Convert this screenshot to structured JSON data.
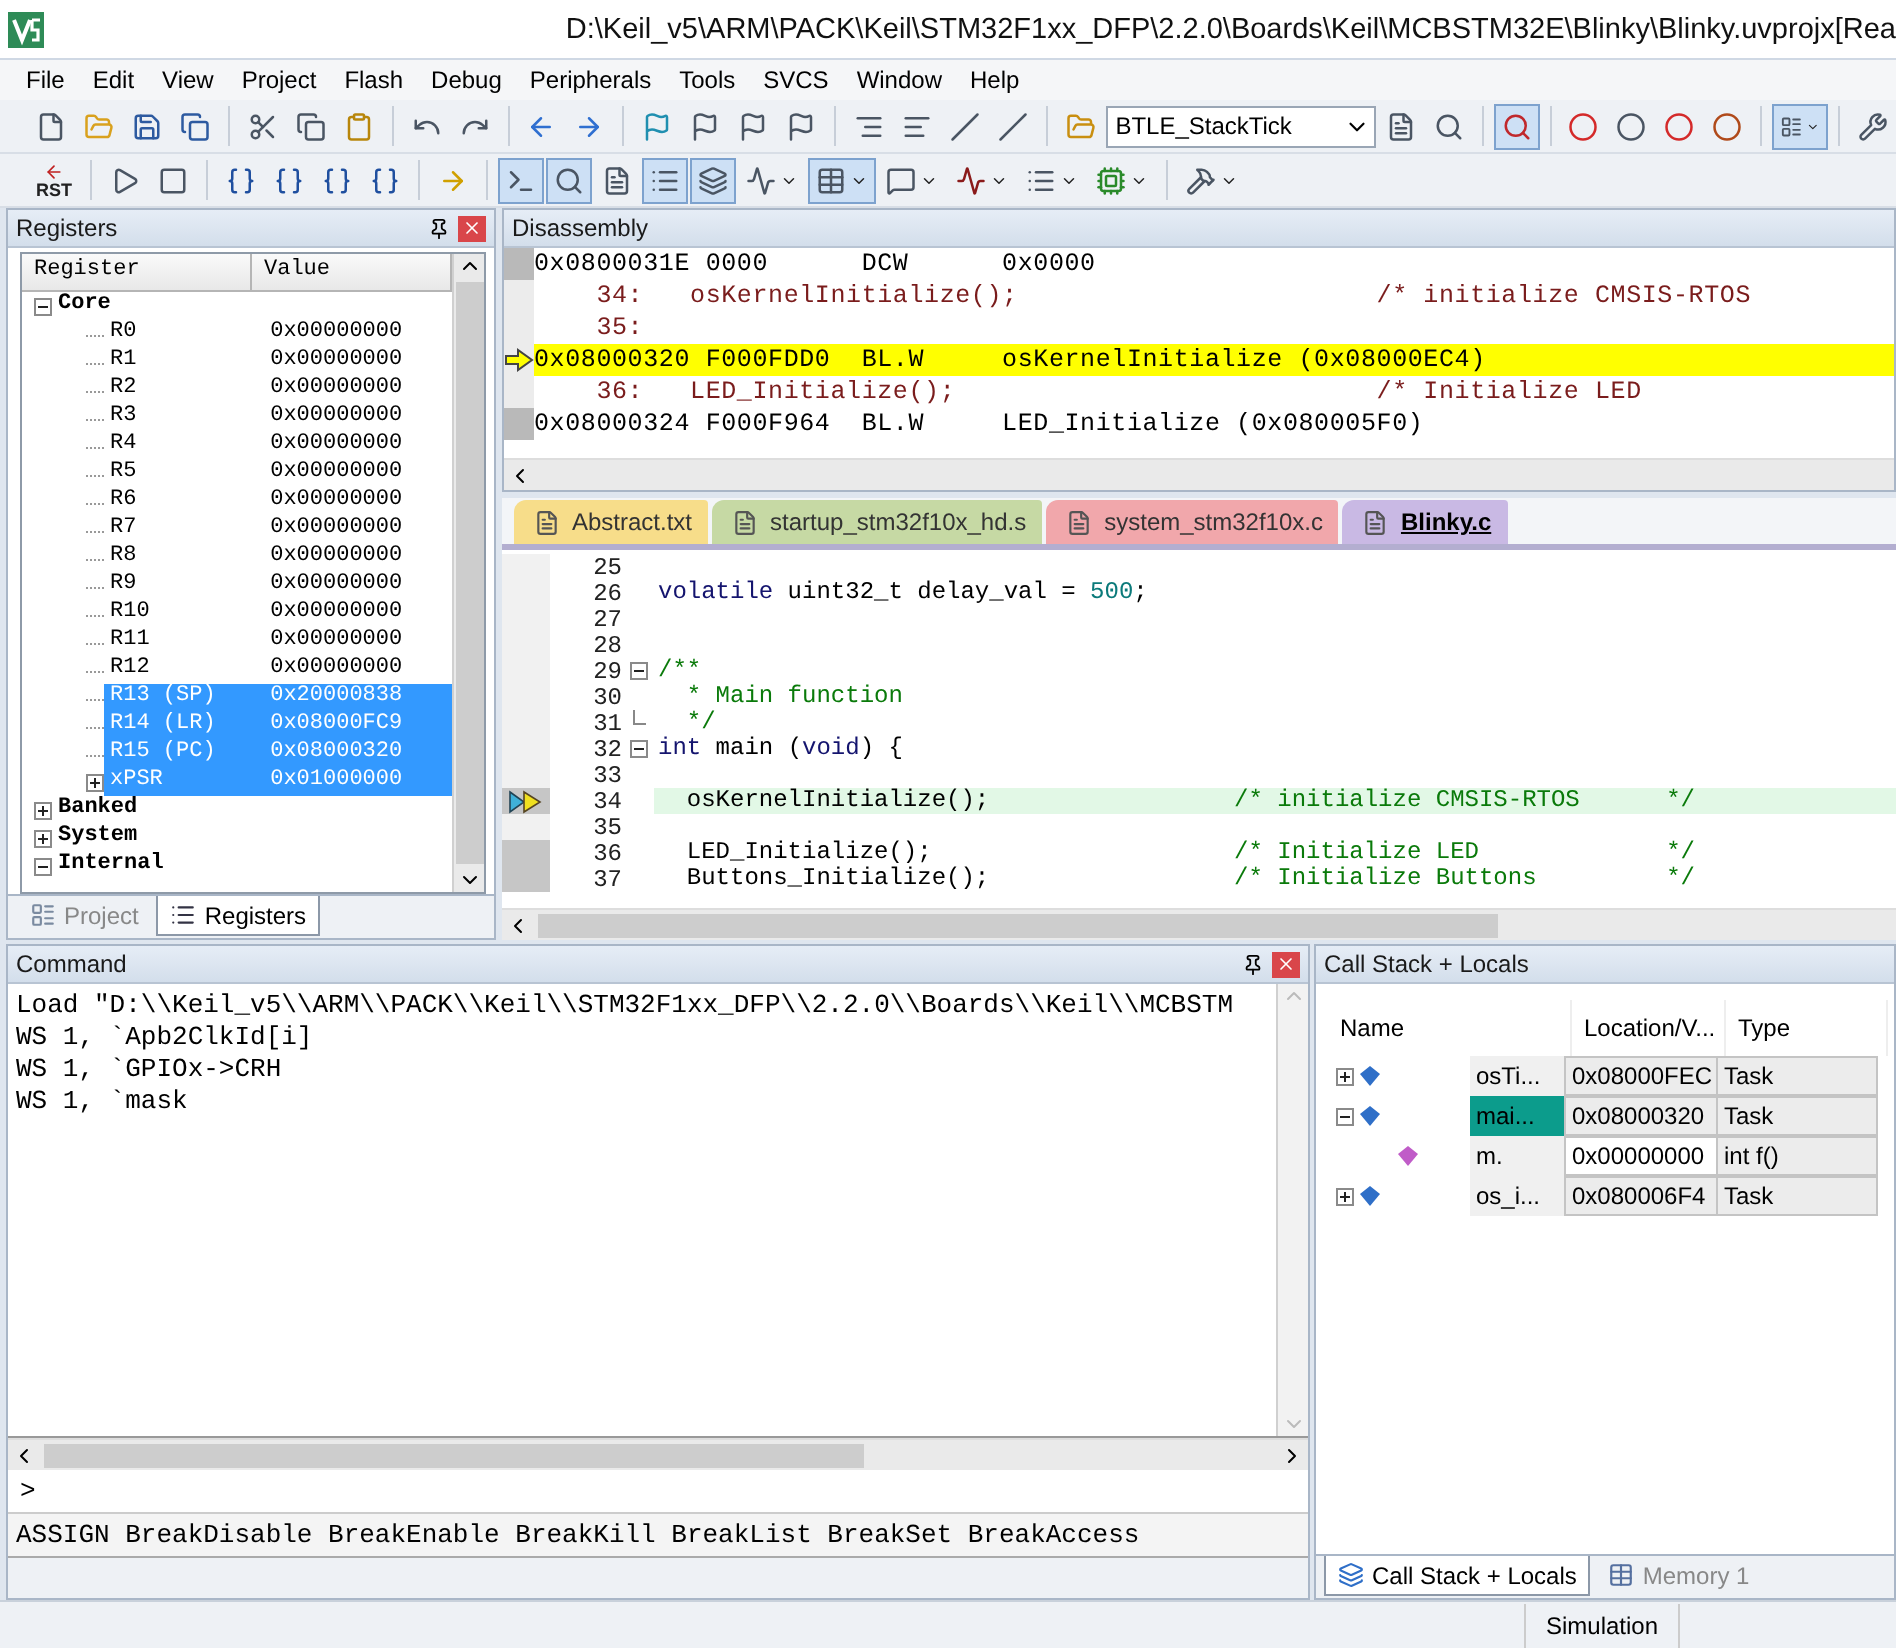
{
  "window": {
    "title": "D:\\Keil_v5\\ARM\\PACK\\Keil\\STM32F1xx_DFP\\2.2.0\\Boards\\Keil\\MCBSTM32E\\Blinky\\Blinky.uvprojx[Rea"
  },
  "menu": [
    "File",
    "Edit",
    "View",
    "Project",
    "Flash",
    "Debug",
    "Peripherals",
    "Tools",
    "SVCS",
    "Window",
    "Help"
  ],
  "toolbar": [
    {
      "kind": "new",
      "pressed": false
    },
    {
      "kind": "open",
      "pressed": false
    },
    {
      "kind": "save",
      "pressed": false
    },
    {
      "kind": "save-all",
      "pressed": false
    },
    {
      "kind": "sep"
    },
    {
      "kind": "cut",
      "pressed": false
    },
    {
      "kind": "copy",
      "pressed": false
    },
    {
      "kind": "paste",
      "pressed": false
    },
    {
      "kind": "sep"
    },
    {
      "kind": "undo",
      "pressed": false
    },
    {
      "kind": "redo",
      "pressed": false
    },
    {
      "kind": "sep"
    },
    {
      "kind": "back",
      "pressed": false
    },
    {
      "kind": "forward",
      "pressed": false
    },
    {
      "kind": "sep"
    },
    {
      "kind": "bookmark",
      "pressed": false
    },
    {
      "kind": "bookmark-prev",
      "pressed": false
    },
    {
      "kind": "bookmark-next",
      "pressed": false
    },
    {
      "kind": "bookmark-clear",
      "pressed": false
    },
    {
      "kind": "sep"
    },
    {
      "kind": "indent",
      "pressed": false
    },
    {
      "kind": "outdent",
      "pressed": false
    },
    {
      "kind": "comment",
      "pressed": false
    },
    {
      "kind": "uncomment",
      "pressed": false
    },
    {
      "kind": "sep"
    },
    {
      "kind": "find-files",
      "pressed": false
    },
    {
      "kind": "combo",
      "value": "BTLE_StackTick"
    },
    {
      "kind": "find",
      "pressed": false
    },
    {
      "kind": "incremental",
      "pressed": false
    },
    {
      "kind": "sep"
    },
    {
      "kind": "debug",
      "pressed": true
    },
    {
      "kind": "sep"
    },
    {
      "kind": "breakpoint",
      "pressed": false
    },
    {
      "kind": "breakpoint-off",
      "pressed": false
    },
    {
      "kind": "kill-breakpoints",
      "pressed": false
    },
    {
      "kind": "disable-breakpoints",
      "pressed": false
    },
    {
      "kind": "sep"
    },
    {
      "kind": "windows",
      "pressed": true,
      "menu": true
    },
    {
      "kind": "sep"
    },
    {
      "kind": "config",
      "pressed": false
    }
  ],
  "debug_toolbar": [
    {
      "kind": "reset",
      "label": "RST",
      "pressed": false
    },
    {
      "kind": "sep"
    },
    {
      "kind": "run",
      "pressed": false
    },
    {
      "kind": "stop",
      "pressed": false
    },
    {
      "kind": "sep"
    },
    {
      "kind": "step",
      "pressed": false
    },
    {
      "kind": "step-over",
      "pressed": false
    },
    {
      "kind": "step-out",
      "pressed": false
    },
    {
      "kind": "run-to-cursor",
      "pressed": false
    },
    {
      "kind": "sep"
    },
    {
      "kind": "show-next",
      "pressed": false
    },
    {
      "kind": "sep"
    },
    {
      "kind": "command-window",
      "pressed": true
    },
    {
      "kind": "disassembly-window",
      "pressed": true
    },
    {
      "kind": "symbols-window",
      "pressed": false
    },
    {
      "kind": "registers-window",
      "pressed": true
    },
    {
      "kind": "call-stack-window",
      "pressed": true
    },
    {
      "kind": "watch-window",
      "pressed": false,
      "menu": true
    },
    {
      "kind": "memory-window",
      "pressed": true,
      "menu": true
    },
    {
      "kind": "serial-window",
      "pressed": false,
      "menu": true
    },
    {
      "kind": "analysis-window",
      "pressed": false,
      "menu": true
    },
    {
      "kind": "trace-window",
      "pressed": false,
      "menu": true
    },
    {
      "kind": "system-viewer",
      "pressed": false,
      "menu": true
    },
    {
      "kind": "sep"
    },
    {
      "kind": "toolbox",
      "pressed": false,
      "menu": true
    }
  ],
  "registers": {
    "title": "Registers",
    "columns": [
      "Register",
      "Value"
    ],
    "tree": [
      {
        "name": "Core",
        "expanded": true,
        "selected": false,
        "children": [
          {
            "name": "R0",
            "value": "0x00000000",
            "selected": false
          },
          {
            "name": "R1",
            "value": "0x00000000",
            "selected": false
          },
          {
            "name": "R2",
            "value": "0x00000000",
            "selected": false
          },
          {
            "name": "R3",
            "value": "0x00000000",
            "selected": false
          },
          {
            "name": "R4",
            "value": "0x00000000",
            "selected": false
          },
          {
            "name": "R5",
            "value": "0x00000000",
            "selected": false
          },
          {
            "name": "R6",
            "value": "0x00000000",
            "selected": false
          },
          {
            "name": "R7",
            "value": "0x00000000",
            "selected": false
          },
          {
            "name": "R8",
            "value": "0x00000000",
            "selected": false
          },
          {
            "name": "R9",
            "value": "0x00000000",
            "selected": false
          },
          {
            "name": "R10",
            "value": "0x00000000",
            "selected": false
          },
          {
            "name": "R11",
            "value": "0x00000000",
            "selected": false
          },
          {
            "name": "R12",
            "value": "0x00000000",
            "selected": false
          },
          {
            "name": "R13 (SP)",
            "value": "0x20000838",
            "selected": true
          },
          {
            "name": "R14 (LR)",
            "value": "0x08000FC9",
            "selected": true
          },
          {
            "name": "R15 (PC)",
            "value": "0x08000320",
            "selected": true
          },
          {
            "name": "xPSR",
            "value": "0x01000000",
            "selected": true,
            "expanded": false
          }
        ]
      },
      {
        "name": "Banked",
        "expanded": false,
        "selected": false
      },
      {
        "name": "System",
        "expanded": false,
        "selected": false
      },
      {
        "name": "Internal",
        "expanded": true,
        "selected": false
      }
    ],
    "tabs": [
      {
        "label": "Project",
        "kind": "project",
        "selected": false
      },
      {
        "label": "Registers",
        "kind": "registers",
        "selected": true
      }
    ]
  },
  "disassembly": {
    "title": "Disassembly",
    "lines": [
      {
        "kind": "asm",
        "text": "0x0800031E 0000      DCW      0x0000",
        "current": false
      },
      {
        "kind": "src",
        "text": "    34:   osKernelInitialize();                       /* initialize CMSIS-RTOS",
        "current": false
      },
      {
        "kind": "src",
        "text": "    35:",
        "current": false
      },
      {
        "kind": "asm",
        "text": "0x08000320 F000FDD0  BL.W     osKernelInitialize (0x08000EC4)",
        "current": true
      },
      {
        "kind": "src",
        "text": "    36:   LED_Initialize();                           /* Initialize LED",
        "current": false
      },
      {
        "kind": "asm",
        "text": "0x08000324 F000F964  BL.W     LED_Initialize (0x080005F0)",
        "current": false
      }
    ]
  },
  "editor": {
    "tabs": [
      {
        "label": "Abstract.txt",
        "color": "#f7dd8a",
        "selected": false
      },
      {
        "label": "startup_stm32f10x_hd.s",
        "color": "#c6d9a4",
        "selected": false
      },
      {
        "label": "system_stm32f10x.c",
        "color": "#f1a7ab",
        "selected": false
      },
      {
        "label": "Blinky.c",
        "color": "#c9b9e4",
        "selected": true
      }
    ],
    "lines": [
      {
        "number": "25",
        "kind": "plain"
      },
      {
        "number": "26",
        "kind": "plain",
        "segments": [
          {
            "kind": "keyword",
            "text": "volatile"
          },
          {
            "kind": "plain",
            "text": " uint32_t delay_val = "
          },
          {
            "kind": "number",
            "text": "500"
          },
          {
            "kind": "plain",
            "text": ";"
          }
        ]
      },
      {
        "number": "27",
        "kind": "plain"
      },
      {
        "number": "28",
        "kind": "plain"
      },
      {
        "number": "29",
        "kind": "fold-start",
        "segments": [
          {
            "kind": "comment",
            "text": "/**"
          }
        ]
      },
      {
        "number": "30",
        "kind": "plain",
        "segments": [
          {
            "kind": "comment",
            "text": "  * Main function"
          }
        ]
      },
      {
        "number": "31",
        "kind": "fold-end",
        "segments": [
          {
            "kind": "comment",
            "text": "  */"
          }
        ]
      },
      {
        "number": "32",
        "kind": "fold-start",
        "segments": [
          {
            "kind": "keyword",
            "text": "int"
          },
          {
            "kind": "plain",
            "text": " main ("
          },
          {
            "kind": "keyword",
            "text": "void"
          },
          {
            "kind": "plain",
            "text": ") {"
          }
        ]
      },
      {
        "number": "33",
        "kind": "plain"
      },
      {
        "number": "34",
        "kind": "current",
        "segments": [
          {
            "kind": "plain",
            "text": "  osKernelInitialize();                 "
          },
          {
            "kind": "comment",
            "text": "/* initialize CMSIS-RTOS      */"
          }
        ]
      },
      {
        "number": "35",
        "kind": "plain"
      },
      {
        "number": "36",
        "kind": "executable",
        "segments": [
          {
            "kind": "plain",
            "text": "  LED_Initialize();                     "
          },
          {
            "kind": "comment",
            "text": "/* Initialize LED             */"
          }
        ]
      },
      {
        "number": "37",
        "kind": "executable",
        "segments": [
          {
            "kind": "plain",
            "text": "  Buttons_Initialize();                 "
          },
          {
            "kind": "comment",
            "text": "/* Initialize Buttons         */"
          }
        ]
      }
    ]
  },
  "command": {
    "title": "Command",
    "output": [
      "Load \"D:\\\\Keil_v5\\\\ARM\\\\PACK\\\\Keil\\\\STM32F1xx_DFP\\\\2.2.0\\\\Boards\\\\Keil\\\\MCBSTM",
      "WS 1, `Apb2ClkId[i]",
      "WS 1, `GPIOx->CRH",
      "WS 1, `mask"
    ],
    "prompt": ">",
    "hint": "ASSIGN BreakDisable BreakEnable BreakKill BreakList BreakSet BreakAccess"
  },
  "call_stack": {
    "title": "Call Stack + Locals",
    "columns": [
      "Name",
      "Location/V...",
      "Type"
    ],
    "rows": [
      {
        "name": "osTi...",
        "location": "0x08000FEC",
        "type": "Task",
        "kind": "task",
        "expanded": false,
        "selected": false
      },
      {
        "name": "mai...",
        "location": "0x08000320",
        "type": "Task",
        "kind": "task",
        "expanded": true,
        "selected": true,
        "children": [
          {
            "name": "m.",
            "location": "0x00000000",
            "type": "int f()",
            "kind": "function",
            "selected": false
          }
        ]
      },
      {
        "name": "os_i...",
        "location": "0x080006F4",
        "type": "Task",
        "kind": "task",
        "expanded": false,
        "selected": false
      }
    ],
    "tabs": [
      {
        "label": "Call Stack + Locals",
        "kind": "call-stack",
        "selected": true
      },
      {
        "label": "Memory 1",
        "kind": "memory",
        "selected": false
      }
    ]
  },
  "status_bar": {
    "mode": "Simulation"
  }
}
